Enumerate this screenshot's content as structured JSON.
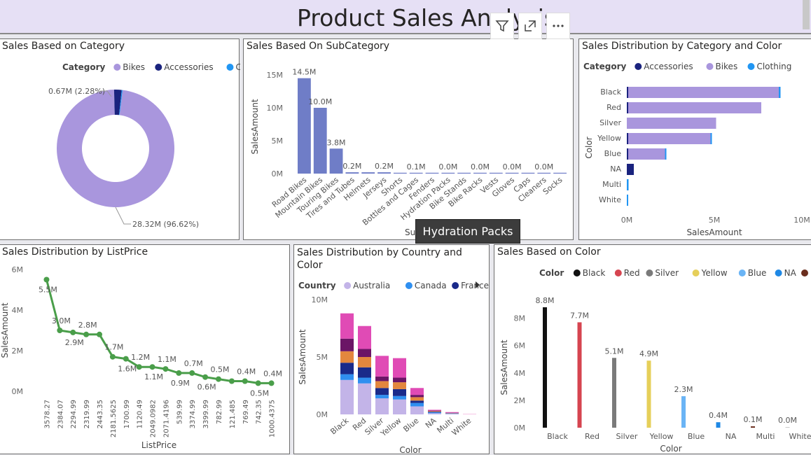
{
  "dashboard": {
    "title": "Product Sales Analysis"
  },
  "icons": {
    "filter": "filter-icon",
    "focus": "focus-mode-icon",
    "more": "more-options-icon"
  },
  "tooltip": {
    "text": "Hydration Packs"
  },
  "colors": {
    "bikes": "#a996dd",
    "accessories": "#1a237e",
    "clothing": "#2196f3",
    "subcat_bar": "#6f7dc7",
    "line": "#4a9e4a",
    "australia": "#c3b4e8",
    "canada": "#2f8ff0",
    "france": "#1a2a8a",
    "germany": "#e3873e",
    "uk": "#6b1566",
    "us": "#e04bb5"
  },
  "chart_data": [
    {
      "id": "category",
      "type": "pie",
      "title": "Sales Based on Category",
      "legend_title": "Category",
      "legend": [
        "Bikes",
        "Accessories",
        "Clothing"
      ],
      "slices": [
        {
          "name": "Bikes",
          "value": 28.32,
          "label": "28.32M (96.62%)",
          "color": "#a996dd"
        },
        {
          "name": "Accessories",
          "value": 0.6,
          "label": "",
          "color": "#1a237e"
        },
        {
          "name": "Clothing",
          "value": 0.07,
          "label": "0.67M (2.28%)",
          "color": "#2196f3"
        }
      ],
      "labels": [
        "0.67M (2.28%)",
        "28.32M (96.62%)"
      ]
    },
    {
      "id": "subcategory",
      "type": "bar",
      "title": "Sales Based On SubCategory",
      "ylabel": "SalesAmount",
      "xlabel_partial": "Su",
      "yticks": [
        "0M",
        "5M",
        "10M",
        "15M"
      ],
      "ylim": [
        0,
        15
      ],
      "categories": [
        "Road Bikes",
        "Mountain Bikes",
        "Touring Bikes",
        "Tires and Tubes",
        "Helmets",
        "Jerseys",
        "Shorts",
        "Bottles and Cages",
        "Fenders",
        "Hydration Packs",
        "Bike Stands",
        "Bike Racks",
        "Vests",
        "Gloves",
        "Caps",
        "Cleaners",
        "Socks"
      ],
      "values": [
        14.5,
        10.0,
        3.8,
        0.2,
        0.2,
        0.2,
        0.1,
        0.1,
        0.05,
        0.04,
        0.04,
        0.04,
        0.03,
        0.03,
        0.02,
        0.01,
        0.01
      ],
      "data_labels": [
        "14.5M",
        "10.0M",
        "3.8M",
        "0.2M",
        "",
        "0.2M",
        "",
        "0.1M",
        "",
        "0.0M",
        "",
        "0.0M",
        "",
        "0.0M",
        "",
        "0.0M",
        ""
      ]
    },
    {
      "id": "category-color",
      "type": "bar",
      "orientation": "horizontal",
      "title": "Sales Distribution by Category and Color",
      "legend_title": "Category",
      "legend": [
        "Accessories",
        "Bikes",
        "Clothing"
      ],
      "ylabel": "Color",
      "xlabel": "SalesAmount",
      "xticks": [
        "0M",
        "5M",
        "10M"
      ],
      "xlim": [
        0,
        10
      ],
      "categories": [
        "Black",
        "Red",
        "Silver",
        "Yellow",
        "Blue",
        "NA",
        "Multi",
        "White"
      ],
      "series": [
        {
          "name": "Accessories",
          "values": [
            0.05,
            0.05,
            0,
            0.05,
            0.05,
            0.4,
            0,
            0
          ]
        },
        {
          "name": "Bikes",
          "values": [
            8.6,
            7.6,
            5.1,
            4.7,
            2.1,
            0,
            0,
            0
          ]
        },
        {
          "name": "Clothing",
          "values": [
            0.1,
            0,
            0,
            0.08,
            0.05,
            0,
            0.1,
            0.01
          ]
        }
      ]
    },
    {
      "id": "listprice",
      "type": "line",
      "title": "Sales Distribution by ListPrice",
      "ylabel": "SalesAmount",
      "xlabel": "ListPrice",
      "yticks": [
        "0M",
        "2M",
        "4M",
        "6M"
      ],
      "ylim": [
        0,
        6
      ],
      "x": [
        "3578.27",
        "2384.07",
        "2294.99",
        "2319.99",
        "2443.35",
        "2181.5625",
        "1700.99",
        "1120.49",
        "2049.0982",
        "2071.4196",
        "539.99",
        "3374.99",
        "3399.99",
        "782.99",
        "121.485",
        "769.49",
        "742.35",
        "1000.4375"
      ],
      "y": [
        5.5,
        3.0,
        2.9,
        2.8,
        2.8,
        1.7,
        1.6,
        1.2,
        1.2,
        1.1,
        0.9,
        0.9,
        0.7,
        0.6,
        0.5,
        0.5,
        0.4,
        0.4
      ],
      "data_labels": [
        "5.5M",
        "3.0M",
        "2.9M",
        "2.8M",
        "",
        "1.7M",
        "1.6M",
        "1.2M",
        "1.1M",
        "1.1M",
        "0.9M",
        "0.7M",
        "0.6M",
        "0.5M",
        "",
        "0.4M",
        "0.5M",
        "0.4M"
      ]
    },
    {
      "id": "country-color",
      "type": "bar",
      "stacked": true,
      "title": "Sales Distribution by Country and Color",
      "legend_title": "Country",
      "legend": [
        "Australia",
        "Canada",
        "France"
      ],
      "ylabel": "SalesAmount",
      "xlabel": "Color",
      "yticks": [
        "0M",
        "5M",
        "10M"
      ],
      "ylim": [
        0,
        10
      ],
      "categories": [
        "Black",
        "Red",
        "Silver",
        "Yellow",
        "Blue",
        "NA",
        "Multi",
        "White"
      ],
      "series": [
        {
          "key": "australia",
          "values": [
            3.0,
            2.7,
            1.4,
            1.3,
            0.7,
            0.1,
            0.05,
            0
          ]
        },
        {
          "key": "canada",
          "values": [
            0.5,
            0.5,
            0.3,
            0.3,
            0.3,
            0.08,
            0.03,
            0
          ]
        },
        {
          "key": "france",
          "values": [
            1.0,
            0.9,
            0.6,
            0.6,
            0.2,
            0.05,
            0.02,
            0
          ]
        },
        {
          "key": "germany",
          "values": [
            1.0,
            0.9,
            0.6,
            0.6,
            0.3,
            0.06,
            0.02,
            0
          ]
        },
        {
          "key": "uk",
          "values": [
            1.1,
            0.7,
            0.4,
            0.4,
            0.2,
            0.04,
            0.02,
            0
          ]
        },
        {
          "key": "us",
          "values": [
            2.2,
            2.0,
            1.8,
            1.7,
            0.6,
            0.07,
            0.06,
            0.02
          ]
        }
      ]
    },
    {
      "id": "color",
      "type": "bar",
      "title": "Sales Based on Color",
      "legend_title": "Color",
      "legend": [
        "Black",
        "Red",
        "Silver",
        "Yellow",
        "Blue",
        "NA",
        "Multi",
        "White"
      ],
      "ylabel": "SalesAmount",
      "xlabel": "Color",
      "yticks": [
        "0M",
        "2M",
        "4M",
        "6M",
        "8M"
      ],
      "ylim": [
        0,
        9
      ],
      "categories": [
        "Black",
        "Red",
        "Silver",
        "Yellow",
        "Blue",
        "NA",
        "Multi",
        "White"
      ],
      "values": [
        8.8,
        7.7,
        5.1,
        4.9,
        2.3,
        0.4,
        0.1,
        0.0
      ],
      "data_labels": [
        "8.8M",
        "7.7M",
        "5.1M",
        "4.9M",
        "2.3M",
        "0.4M",
        "0.1M",
        "0.0M"
      ],
      "colors": [
        "#111111",
        "#d64550",
        "#7a7a7a",
        "#e6cf5a",
        "#6ab4f5",
        "#1e88e5",
        "#6b2e1e",
        "#c8c8c8"
      ]
    }
  ]
}
